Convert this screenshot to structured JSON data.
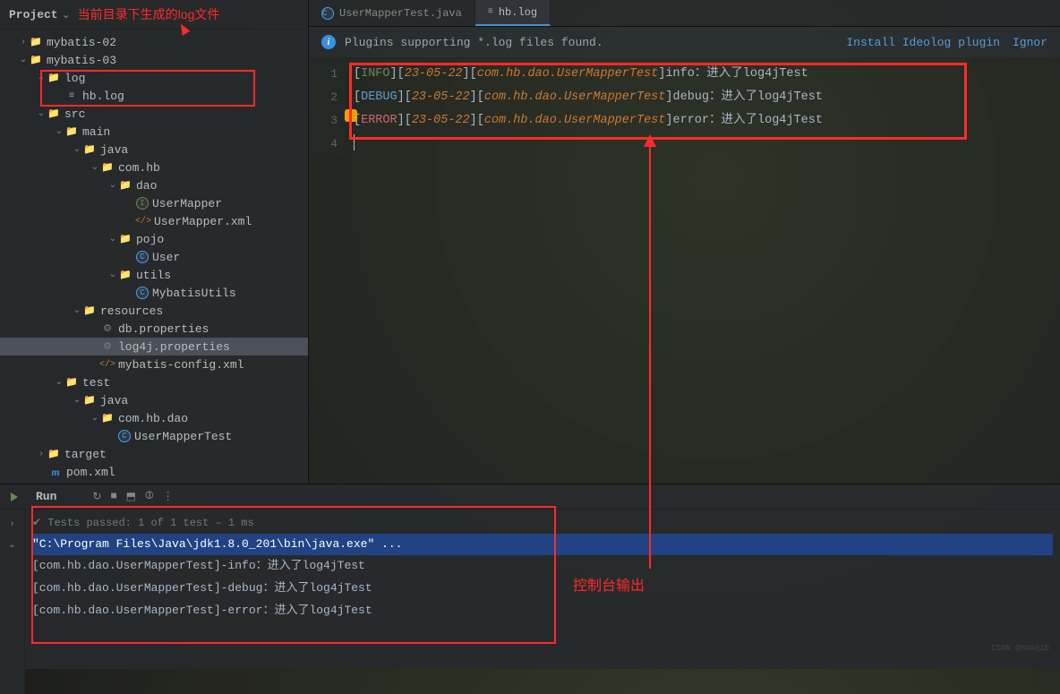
{
  "sidebar": {
    "title": "Project",
    "annotation": "当前目录下生成的log文件"
  },
  "tree": {
    "mybatis02": "mybatis-02",
    "mybatis03": "mybatis-03",
    "log": "log",
    "hblog": "hb.log",
    "src": "src",
    "main": "main",
    "java": "java",
    "comhb": "com.hb",
    "dao": "dao",
    "usermapper": "UserMapper",
    "usermapperxml": "UserMapper.xml",
    "pojo": "pojo",
    "user": "User",
    "utils": "utils",
    "mybatisutils": "MybatisUtils",
    "resources": "resources",
    "dbprops": "db.properties",
    "log4jprops": "log4j.properties",
    "mybatisconfig": "mybatis-config.xml",
    "test": "test",
    "testjava": "java",
    "comhbdao": "com.hb.dao",
    "usermappertest": "UserMapperTest",
    "target": "target",
    "pom": "pom.xml"
  },
  "tabs": {
    "t1": "UserMapperTest.java",
    "t2": "hb.log"
  },
  "notif": {
    "msg": "Plugins supporting *.log files found.",
    "a1": "Install Ideolog plugin",
    "a2": "Ignor"
  },
  "gutter": {
    "l1": "1",
    "l2": "2",
    "l3": "3",
    "l4": "4"
  },
  "log": {
    "l1": {
      "level": "INFO",
      "date": "23-05-22",
      "class": "com.hb.dao.UserMapperTest",
      "msg": "info：进入了log4jTest"
    },
    "l2": {
      "level": "DEBUG",
      "date": "23-05-22",
      "class": "com.hb.dao.UserMapperTest",
      "msg": "debug：进入了log4jTest"
    },
    "l3": {
      "level": "ERROR",
      "date": "23-05-22",
      "class": "com.hb.dao.UserMapperTest",
      "msg": "error：进入了log4jTest"
    }
  },
  "run": {
    "label": "Run",
    "tests": "Tests passed: 1 of 1 test – 1 ms",
    "c1": "\"C:\\Program Files\\Java\\jdk1.8.0_201\\bin\\java.exe\" ...",
    "c2": "[com.hb.dao.UserMapperTest]-info：进入了log4jTest",
    "c3": "[com.hb.dao.UserMapperTest]-debug：进入了log4jTest",
    "c4": "[com.hb.dao.UserMapperTest]-error：进入了log4jTest",
    "annotation": "控制台输出"
  },
  "watermark": "CSDN @Hdaqib"
}
